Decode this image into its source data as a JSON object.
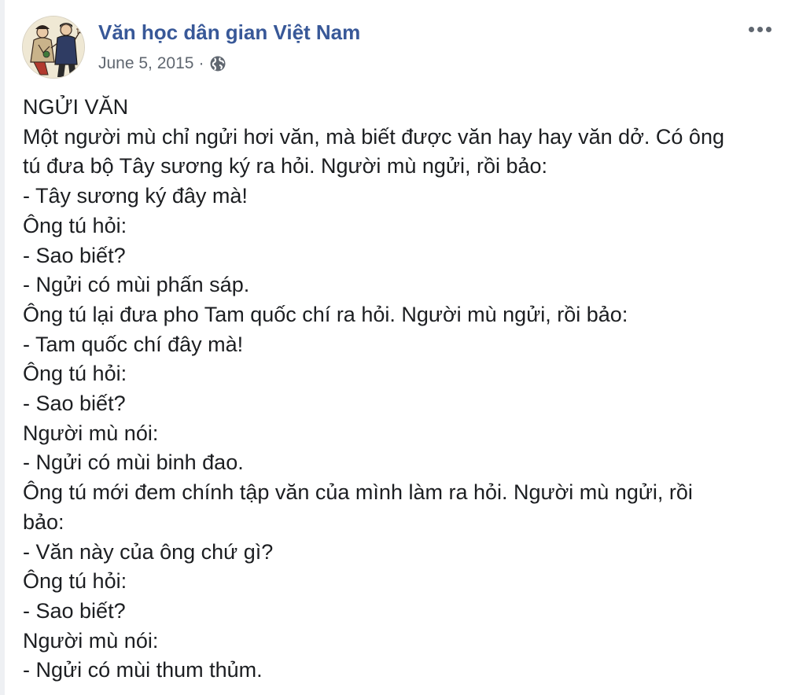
{
  "post": {
    "author": "Văn học dân gian Việt Nam",
    "date": "June 5, 2015",
    "separator": "·",
    "privacy_icon": "globe-icon",
    "more_icon": "more-options-icon",
    "lines": [
      "NGỬI VĂN",
      "Một người mù chỉ ngửi hơi văn, mà biết được văn hay hay văn dở. Có ông",
      "tú đưa bộ Tây sương ký ra hỏi. Người mù ngửi, rồi bảo:",
      "- Tây sương ký đây mà!",
      "Ông tú hỏi:",
      "- Sao biết?",
      "- Ngửi có mùi phấn sáp.",
      "Ông tú lại đưa pho Tam quốc chí ra hỏi. Người mù ngửi, rồi bảo:",
      "- Tam quốc chí đây mà!",
      "Ông tú hỏi:",
      "- Sao biết?",
      "Người mù nói:",
      "- Ngửi có mùi binh đao.",
      "Ông tú mới đem chính tập văn của mình làm ra hỏi. Người mù ngửi, rồi",
      "bảo:",
      "- Văn này của ông chứ gì?",
      "Ông tú hỏi:",
      "- Sao biết?",
      "Người mù nói:",
      "- Ngửi có mùi thum thủm."
    ]
  },
  "colors": {
    "author_link": "#385898",
    "meta_text": "#606770",
    "body_text": "#1c1e21"
  }
}
